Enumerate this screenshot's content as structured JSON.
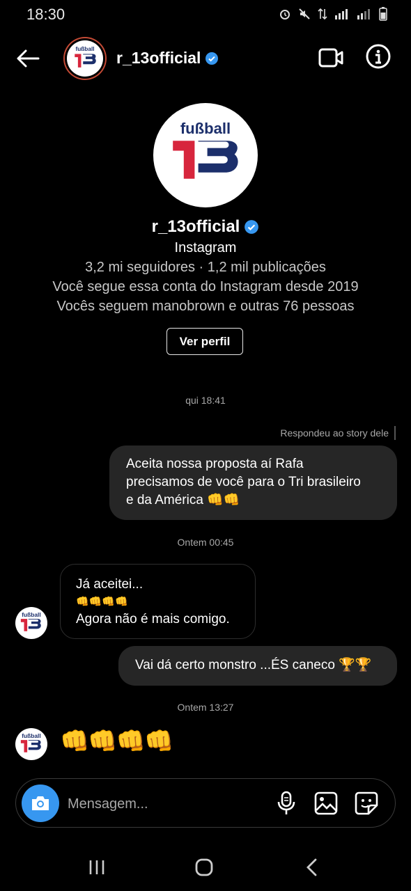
{
  "status_bar": {
    "time": "18:30"
  },
  "header": {
    "username": "r_13official"
  },
  "logo": {
    "top_text": "fußball",
    "number": "13"
  },
  "profile": {
    "name": "r_13official",
    "source": "Instagram",
    "stats": "3,2 mi seguidores · 1,2 mil publicações",
    "follow_since": "Você segue essa conta do Instagram desde 2019",
    "mutual": "Vocês seguem manobrown e outras 76 pessoas",
    "view_profile_label": "Ver perfil"
  },
  "messages": {
    "ts1": "qui 18:41",
    "story_reply_label": "Respondeu ao story dele",
    "msg1_line1": "Aceita nossa proposta aí Rafa",
    "msg1_line2": "precisamos de você para o Tri brasileiro",
    "msg1_line3": "e da América 👊👊",
    "ts2": "Ontem 00:45",
    "msg2_line1": "Já aceitei...",
    "msg2_line2": "👊👊👊👊",
    "msg2_line3": "Agora não é mais comigo.",
    "msg3": "Vai dá certo monstro ...ÉS caneco 🏆🏆",
    "ts3": "Ontem 13:27",
    "msg4": "👊👊👊👊"
  },
  "composer": {
    "placeholder": "Mensagem..."
  },
  "colors": {
    "background": "#000000",
    "bubble_out": "#262626",
    "camera": "#3797f0",
    "verified": "#3797f0",
    "logo_red": "#d7263d",
    "logo_navy": "#1c2f6b"
  },
  "icons": [
    "back-arrow-icon",
    "verified-badge-icon",
    "video-call-icon",
    "info-icon",
    "camera-icon",
    "microphone-icon",
    "gallery-icon",
    "sticker-icon",
    "nav-recents-icon",
    "nav-home-icon",
    "nav-back-icon"
  ]
}
